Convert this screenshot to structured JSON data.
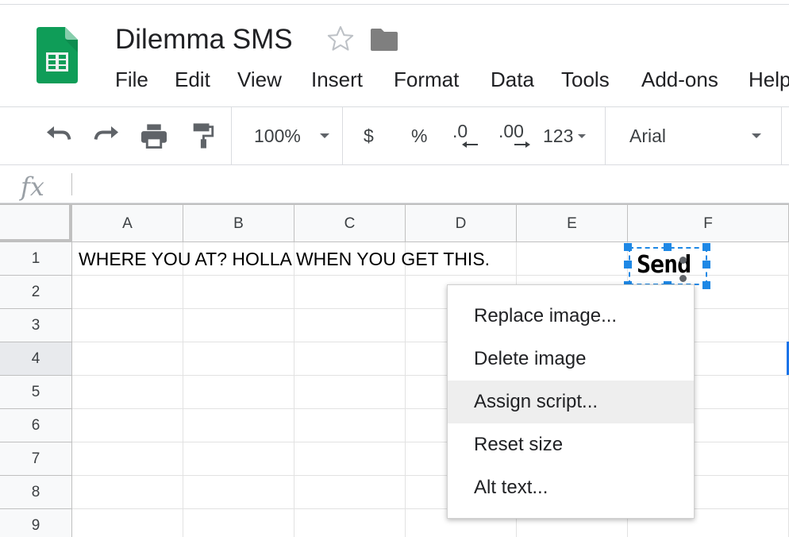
{
  "header": {
    "title": "Dilemma SMS",
    "app_icon": "sheets-logo-icon",
    "star_icon": "star-outline-icon",
    "folder_icon": "folder-icon"
  },
  "menubar": {
    "items": [
      "File",
      "Edit",
      "View",
      "Insert",
      "Format",
      "Data",
      "Tools",
      "Add-ons",
      "Help"
    ]
  },
  "toolbar": {
    "zoom": "100%",
    "currency": "$",
    "percent": "%",
    "decrease_decimals": ".0",
    "increase_decimals": ".00",
    "number_format": "123",
    "font": "Arial",
    "icons": [
      "undo-icon",
      "redo-icon",
      "print-icon",
      "paint-format-icon"
    ]
  },
  "formula_bar": {
    "fx_label": "fx",
    "value": ""
  },
  "grid": {
    "columns": [
      "A",
      "B",
      "C",
      "D",
      "E",
      "F"
    ],
    "rows": [
      "1",
      "2",
      "3",
      "4",
      "5",
      "6",
      "7",
      "8",
      "9"
    ],
    "selected_row": "4",
    "cells": {
      "A1": "WHERE YOU AT? HOLLA WHEN YOU GET THIS."
    }
  },
  "image": {
    "text": "Send"
  },
  "context_menu": {
    "items": [
      "Replace image...",
      "Delete image",
      "Assign script...",
      "Reset size",
      "Alt text..."
    ],
    "highlighted": "Assign script..."
  },
  "colors": {
    "sheets_green": "#0f9d58",
    "selection_blue": "#1e88e5",
    "header_bg": "#f8f9fa"
  }
}
